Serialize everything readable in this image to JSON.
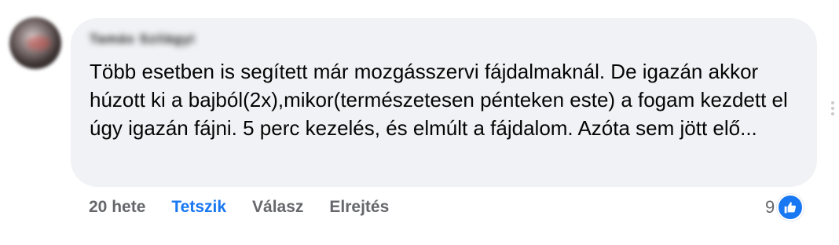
{
  "comment": {
    "author": "Tamás Szilágyi",
    "text": "Több esetben is segített már mozgásszervi fájdalmaknál. De igazán akkor húzott ki a bajból(2x),mikor(természetesen pénteken este) a fogam kezdett el úgy igazán fájni. 5 perc kezelés, és elmúlt a fájdalom. Azóta sem jött elő...",
    "time": "20 hete",
    "like_label": "Tetszik",
    "reply_label": "Válasz",
    "hide_label": "Elrejtés",
    "reaction_count": "9",
    "reaction_icon": "thumbs-up-icon",
    "colors": {
      "accent": "#1877f2",
      "bubble": "#f0f2f5",
      "meta": "#65676b"
    }
  }
}
